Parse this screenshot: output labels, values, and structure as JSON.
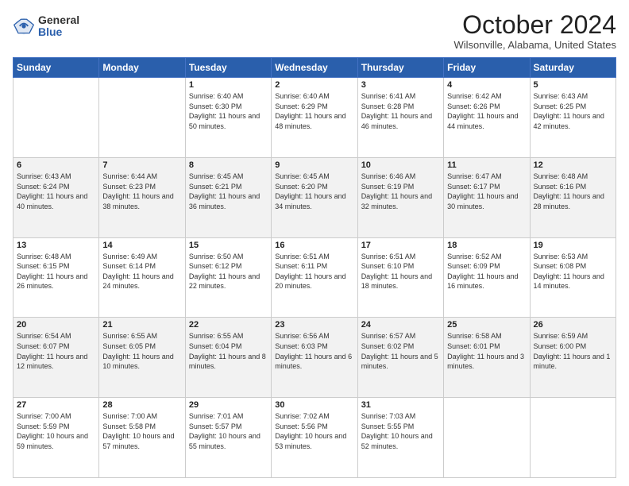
{
  "header": {
    "logo_general": "General",
    "logo_blue": "Blue",
    "month_title": "October 2024",
    "location": "Wilsonville, Alabama, United States"
  },
  "weekdays": [
    "Sunday",
    "Monday",
    "Tuesday",
    "Wednesday",
    "Thursday",
    "Friday",
    "Saturday"
  ],
  "weeks": [
    [
      {
        "day": "",
        "sunrise": "",
        "sunset": "",
        "daylight": ""
      },
      {
        "day": "",
        "sunrise": "",
        "sunset": "",
        "daylight": ""
      },
      {
        "day": "1",
        "sunrise": "Sunrise: 6:40 AM",
        "sunset": "Sunset: 6:30 PM",
        "daylight": "Daylight: 11 hours and 50 minutes."
      },
      {
        "day": "2",
        "sunrise": "Sunrise: 6:40 AM",
        "sunset": "Sunset: 6:29 PM",
        "daylight": "Daylight: 11 hours and 48 minutes."
      },
      {
        "day": "3",
        "sunrise": "Sunrise: 6:41 AM",
        "sunset": "Sunset: 6:28 PM",
        "daylight": "Daylight: 11 hours and 46 minutes."
      },
      {
        "day": "4",
        "sunrise": "Sunrise: 6:42 AM",
        "sunset": "Sunset: 6:26 PM",
        "daylight": "Daylight: 11 hours and 44 minutes."
      },
      {
        "day": "5",
        "sunrise": "Sunrise: 6:43 AM",
        "sunset": "Sunset: 6:25 PM",
        "daylight": "Daylight: 11 hours and 42 minutes."
      }
    ],
    [
      {
        "day": "6",
        "sunrise": "Sunrise: 6:43 AM",
        "sunset": "Sunset: 6:24 PM",
        "daylight": "Daylight: 11 hours and 40 minutes."
      },
      {
        "day": "7",
        "sunrise": "Sunrise: 6:44 AM",
        "sunset": "Sunset: 6:23 PM",
        "daylight": "Daylight: 11 hours and 38 minutes."
      },
      {
        "day": "8",
        "sunrise": "Sunrise: 6:45 AM",
        "sunset": "Sunset: 6:21 PM",
        "daylight": "Daylight: 11 hours and 36 minutes."
      },
      {
        "day": "9",
        "sunrise": "Sunrise: 6:45 AM",
        "sunset": "Sunset: 6:20 PM",
        "daylight": "Daylight: 11 hours and 34 minutes."
      },
      {
        "day": "10",
        "sunrise": "Sunrise: 6:46 AM",
        "sunset": "Sunset: 6:19 PM",
        "daylight": "Daylight: 11 hours and 32 minutes."
      },
      {
        "day": "11",
        "sunrise": "Sunrise: 6:47 AM",
        "sunset": "Sunset: 6:17 PM",
        "daylight": "Daylight: 11 hours and 30 minutes."
      },
      {
        "day": "12",
        "sunrise": "Sunrise: 6:48 AM",
        "sunset": "Sunset: 6:16 PM",
        "daylight": "Daylight: 11 hours and 28 minutes."
      }
    ],
    [
      {
        "day": "13",
        "sunrise": "Sunrise: 6:48 AM",
        "sunset": "Sunset: 6:15 PM",
        "daylight": "Daylight: 11 hours and 26 minutes."
      },
      {
        "day": "14",
        "sunrise": "Sunrise: 6:49 AM",
        "sunset": "Sunset: 6:14 PM",
        "daylight": "Daylight: 11 hours and 24 minutes."
      },
      {
        "day": "15",
        "sunrise": "Sunrise: 6:50 AM",
        "sunset": "Sunset: 6:12 PM",
        "daylight": "Daylight: 11 hours and 22 minutes."
      },
      {
        "day": "16",
        "sunrise": "Sunrise: 6:51 AM",
        "sunset": "Sunset: 6:11 PM",
        "daylight": "Daylight: 11 hours and 20 minutes."
      },
      {
        "day": "17",
        "sunrise": "Sunrise: 6:51 AM",
        "sunset": "Sunset: 6:10 PM",
        "daylight": "Daylight: 11 hours and 18 minutes."
      },
      {
        "day": "18",
        "sunrise": "Sunrise: 6:52 AM",
        "sunset": "Sunset: 6:09 PM",
        "daylight": "Daylight: 11 hours and 16 minutes."
      },
      {
        "day": "19",
        "sunrise": "Sunrise: 6:53 AM",
        "sunset": "Sunset: 6:08 PM",
        "daylight": "Daylight: 11 hours and 14 minutes."
      }
    ],
    [
      {
        "day": "20",
        "sunrise": "Sunrise: 6:54 AM",
        "sunset": "Sunset: 6:07 PM",
        "daylight": "Daylight: 11 hours and 12 minutes."
      },
      {
        "day": "21",
        "sunrise": "Sunrise: 6:55 AM",
        "sunset": "Sunset: 6:05 PM",
        "daylight": "Daylight: 11 hours and 10 minutes."
      },
      {
        "day": "22",
        "sunrise": "Sunrise: 6:55 AM",
        "sunset": "Sunset: 6:04 PM",
        "daylight": "Daylight: 11 hours and 8 minutes."
      },
      {
        "day": "23",
        "sunrise": "Sunrise: 6:56 AM",
        "sunset": "Sunset: 6:03 PM",
        "daylight": "Daylight: 11 hours and 6 minutes."
      },
      {
        "day": "24",
        "sunrise": "Sunrise: 6:57 AM",
        "sunset": "Sunset: 6:02 PM",
        "daylight": "Daylight: 11 hours and 5 minutes."
      },
      {
        "day": "25",
        "sunrise": "Sunrise: 6:58 AM",
        "sunset": "Sunset: 6:01 PM",
        "daylight": "Daylight: 11 hours and 3 minutes."
      },
      {
        "day": "26",
        "sunrise": "Sunrise: 6:59 AM",
        "sunset": "Sunset: 6:00 PM",
        "daylight": "Daylight: 11 hours and 1 minute."
      }
    ],
    [
      {
        "day": "27",
        "sunrise": "Sunrise: 7:00 AM",
        "sunset": "Sunset: 5:59 PM",
        "daylight": "Daylight: 10 hours and 59 minutes."
      },
      {
        "day": "28",
        "sunrise": "Sunrise: 7:00 AM",
        "sunset": "Sunset: 5:58 PM",
        "daylight": "Daylight: 10 hours and 57 minutes."
      },
      {
        "day": "29",
        "sunrise": "Sunrise: 7:01 AM",
        "sunset": "Sunset: 5:57 PM",
        "daylight": "Daylight: 10 hours and 55 minutes."
      },
      {
        "day": "30",
        "sunrise": "Sunrise: 7:02 AM",
        "sunset": "Sunset: 5:56 PM",
        "daylight": "Daylight: 10 hours and 53 minutes."
      },
      {
        "day": "31",
        "sunrise": "Sunrise: 7:03 AM",
        "sunset": "Sunset: 5:55 PM",
        "daylight": "Daylight: 10 hours and 52 minutes."
      },
      {
        "day": "",
        "sunrise": "",
        "sunset": "",
        "daylight": ""
      },
      {
        "day": "",
        "sunrise": "",
        "sunset": "",
        "daylight": ""
      }
    ]
  ]
}
